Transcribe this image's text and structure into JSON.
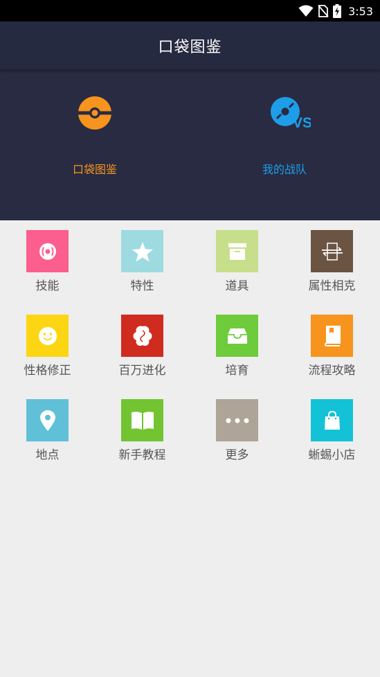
{
  "status_bar": {
    "time": "3:53"
  },
  "app_bar": {
    "title": "口袋图鉴"
  },
  "hero": {
    "pokedex": {
      "label": "口袋图鉴",
      "color": "#f7941d"
    },
    "my_team": {
      "label": "我的战队",
      "badge": "VS",
      "color": "#1e9ee8"
    }
  },
  "grid": {
    "items": [
      {
        "label": "技能",
        "icon": "disc-icon",
        "color": "#fc5e8e"
      },
      {
        "label": "特性",
        "icon": "star-icon",
        "color": "#9ddbe0"
      },
      {
        "label": "道具",
        "icon": "box-icon",
        "color": "#c7df8b"
      },
      {
        "label": "属性相克",
        "icon": "swap-arrows-icon",
        "color": "#6b5442"
      },
      {
        "label": "性格修正",
        "icon": "smiley-icon",
        "color": "#fcd612"
      },
      {
        "label": "百万进化",
        "icon": "pinwheel-icon",
        "color": "#d02b1f"
      },
      {
        "label": "培育",
        "icon": "inbox-icon",
        "color": "#6ecb3c"
      },
      {
        "label": "流程攻略",
        "icon": "book-icon",
        "color": "#f7941d"
      },
      {
        "label": "地点",
        "icon": "map-pin-icon",
        "color": "#5fc0d8"
      },
      {
        "label": "新手教程",
        "icon": "open-book-icon",
        "color": "#72c431"
      },
      {
        "label": "更多",
        "icon": "more-dots-icon",
        "color": "#aea497"
      },
      {
        "label": "蜥蜴小店",
        "icon": "shopping-bag-icon",
        "color": "#13c2d7"
      }
    ]
  }
}
